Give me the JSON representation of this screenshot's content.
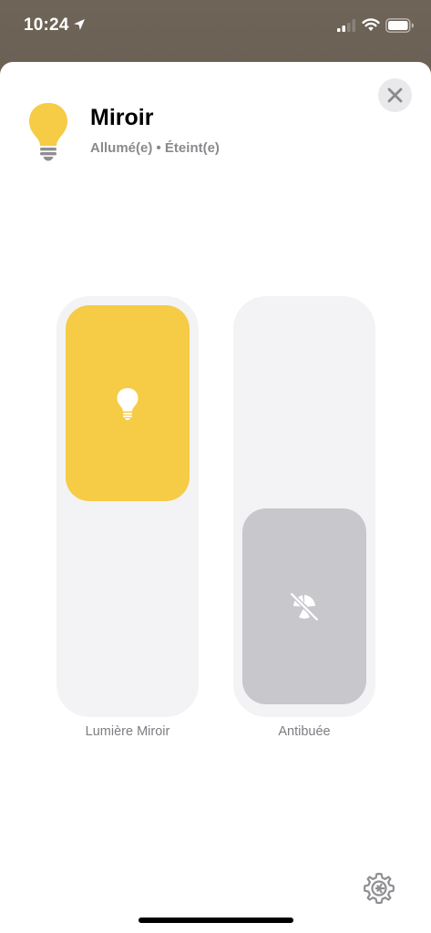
{
  "status_bar": {
    "time": "10:24",
    "icons": [
      "location-arrow-icon",
      "cellular-signal-icon",
      "wifi-icon",
      "battery-icon"
    ]
  },
  "accessory": {
    "icon": "lightbulb-icon",
    "name": "Miroir",
    "status": "Allumé(e) • Éteint(e)"
  },
  "controls": [
    {
      "label": "Lumière Miroir",
      "icon": "lightbulb-icon",
      "state": "on",
      "level": 1.0,
      "color": "#f6cc46"
    },
    {
      "label": "Antibuée",
      "icon": "defog-off-icon",
      "state": "off",
      "level": 0.0,
      "color": "#c7c7cc"
    }
  ],
  "actions": {
    "close_icon": "close-icon",
    "settings_icon": "gear-icon"
  }
}
